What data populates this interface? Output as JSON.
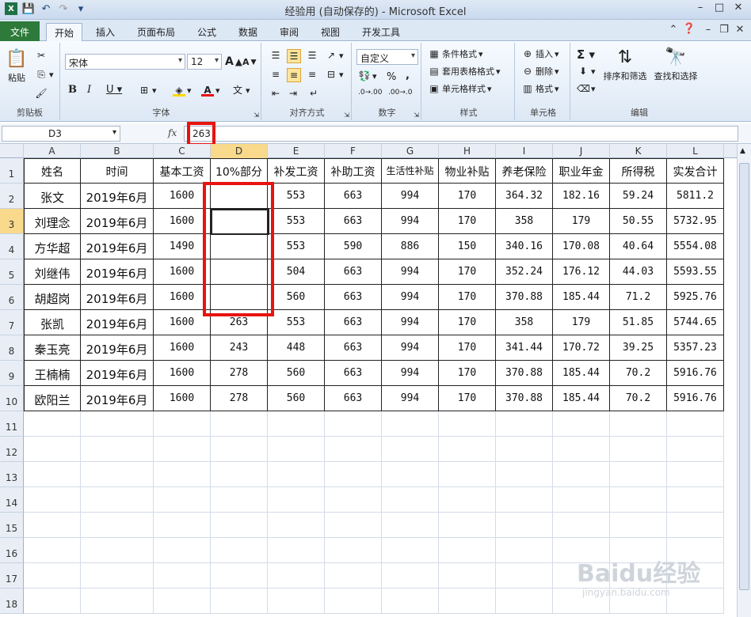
{
  "window": {
    "title": "经验用 (自动保存的)  -  Microsoft Excel"
  },
  "tabs": [
    "文件",
    "开始",
    "插入",
    "页面布局",
    "公式",
    "数据",
    "审阅",
    "视图",
    "开发工具"
  ],
  "ribbon": {
    "clipboard": {
      "label": "剪贴板",
      "paste": "粘贴"
    },
    "font": {
      "label": "字体",
      "name": "宋体",
      "size": "12"
    },
    "alignment": {
      "label": "对齐方式"
    },
    "number": {
      "label": "数字",
      "format": "自定义"
    },
    "styles": {
      "label": "样式",
      "conditional": "条件格式",
      "table": "套用表格格式",
      "cell": "单元格样式"
    },
    "cells": {
      "label": "单元格",
      "insert": "插入",
      "delete": "删除",
      "format": "格式"
    },
    "editing": {
      "label": "编辑",
      "sort": "排序和筛选",
      "find": "查找和选择"
    }
  },
  "formula_bar": {
    "name_box": "D3",
    "formula": "263",
    "fx": "fx"
  },
  "columns": [
    "A",
    "B",
    "C",
    "D",
    "E",
    "F",
    "G",
    "H",
    "I",
    "J",
    "K",
    "L"
  ],
  "selected_column": "D",
  "selected_row": 3,
  "rows": [
    1,
    2,
    3,
    4,
    5,
    6,
    7,
    8,
    9,
    10,
    11,
    12,
    13,
    14,
    15,
    16,
    17,
    18
  ],
  "header": [
    "姓名",
    "时间",
    "基本工资",
    "10%部分",
    "补发工资",
    "补助工资",
    "生活性补贴",
    "物业补贴",
    "养老保险",
    "职业年金",
    "所得税",
    "实发合计"
  ],
  "data": [
    [
      "张文",
      "2019年6月",
      "1600",
      "",
      "553",
      "663",
      "994",
      "170",
      "364.32",
      "182.16",
      "59.24",
      "5811.2"
    ],
    [
      "刘理念",
      "2019年6月",
      "1600",
      "",
      "553",
      "663",
      "994",
      "170",
      "358",
      "179",
      "50.55",
      "5732.95"
    ],
    [
      "方华超",
      "2019年6月",
      "1490",
      "",
      "553",
      "590",
      "886",
      "150",
      "340.16",
      "170.08",
      "40.64",
      "5554.08"
    ],
    [
      "刘继伟",
      "2019年6月",
      "1600",
      "",
      "504",
      "663",
      "994",
      "170",
      "352.24",
      "176.12",
      "44.03",
      "5593.55"
    ],
    [
      "胡超岗",
      "2019年6月",
      "1600",
      "",
      "560",
      "663",
      "994",
      "170",
      "370.88",
      "185.44",
      "71.2",
      "5925.76"
    ],
    [
      "张凯",
      "2019年6月",
      "1600",
      "263",
      "553",
      "663",
      "994",
      "170",
      "358",
      "179",
      "51.85",
      "5744.65"
    ],
    [
      "秦玉亮",
      "2019年6月",
      "1600",
      "243",
      "448",
      "663",
      "994",
      "170",
      "341.44",
      "170.72",
      "39.25",
      "5357.23"
    ],
    [
      "王楠楠",
      "2019年6月",
      "1600",
      "278",
      "560",
      "663",
      "994",
      "170",
      "370.88",
      "185.44",
      "70.2",
      "5916.76"
    ],
    [
      "欧阳兰",
      "2019年6月",
      "1600",
      "278",
      "560",
      "663",
      "994",
      "170",
      "370.88",
      "185.44",
      "70.2",
      "5916.76"
    ]
  ],
  "watermark": {
    "text": "Baidu经验",
    "sub": "jingyan.baidu.com"
  },
  "colors": {
    "highlight": "#e8130f",
    "file_tab": "#2d7a3a",
    "selected_header": "#f9d98b"
  }
}
